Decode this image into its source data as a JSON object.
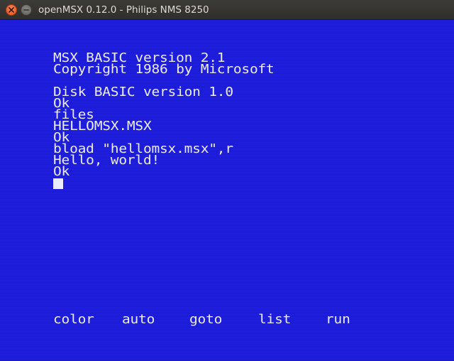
{
  "window": {
    "title": "openMSX 0.12.0 - Philips NMS 8250"
  },
  "screen": {
    "background_color": "#2323df",
    "text_color": "#ececff",
    "lines": [
      "MSX BASIC version 2.1",
      "Copyright 1986 by Microsoft",
      "Disk BASIC version 1.0",
      "Ok",
      "files",
      "HELLOMSX.MSX",
      "Ok",
      "bload \"hellomsx.msx\",r",
      "Hello, world!",
      "Ok"
    ],
    "function_keys": [
      "color",
      "auto",
      "goto",
      "list",
      "run"
    ]
  }
}
